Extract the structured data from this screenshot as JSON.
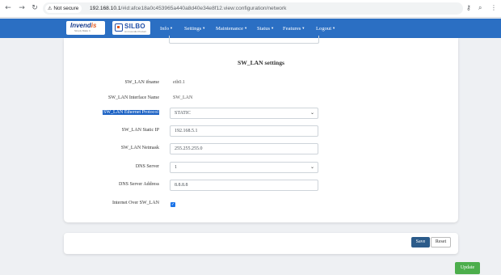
{
  "browser": {
    "security_chip": "Not secure",
    "url_host": "192.168.10.1",
    "url_path": "/#id:afce18a0c453965a440a8d40e34e8f12.view:configuration/network"
  },
  "header": {
    "logo1_main": "Invend",
    "logo1_accent": "is",
    "logo1_sub": "Simply Make It",
    "logo2_main": "SILBO",
    "logo2_sub": "An Invendis Product",
    "menu": [
      "Info",
      "Settings",
      "Maintenance",
      "Status",
      "Features",
      "Logout"
    ]
  },
  "section": {
    "title": "SW_LAN settings",
    "ifname_label": "SW_LAN ifname",
    "ifname_value": "eth0.1",
    "interface_name_label": "SW_LAN Interface Name",
    "interface_name_value": "SW_LAN",
    "protocol_label": "SW_LAN Ethernet Protocol",
    "protocol_value": "STATIC",
    "static_ip_label": "SW_LAN Static IP",
    "static_ip_value": "192.168.5.1",
    "netmask_label": "SW_LAN Netmask",
    "netmask_value": "255.255.255.0",
    "dns_server_label": "DNS Server",
    "dns_server_value": "1",
    "dns_address_label": "DNS Server Address",
    "dns_address_value": "8.8.8.8",
    "internet_label": "Internet Over SW_LAN",
    "internet_checked": true
  },
  "actions": {
    "save": "Save",
    "reset": "Reset",
    "update": "Update"
  },
  "colors": {
    "header_bg": "#2b6fc3",
    "save_bg": "#2b5b8a",
    "update_bg": "#4cae4c",
    "highlight_bg": "#1c62c4"
  }
}
